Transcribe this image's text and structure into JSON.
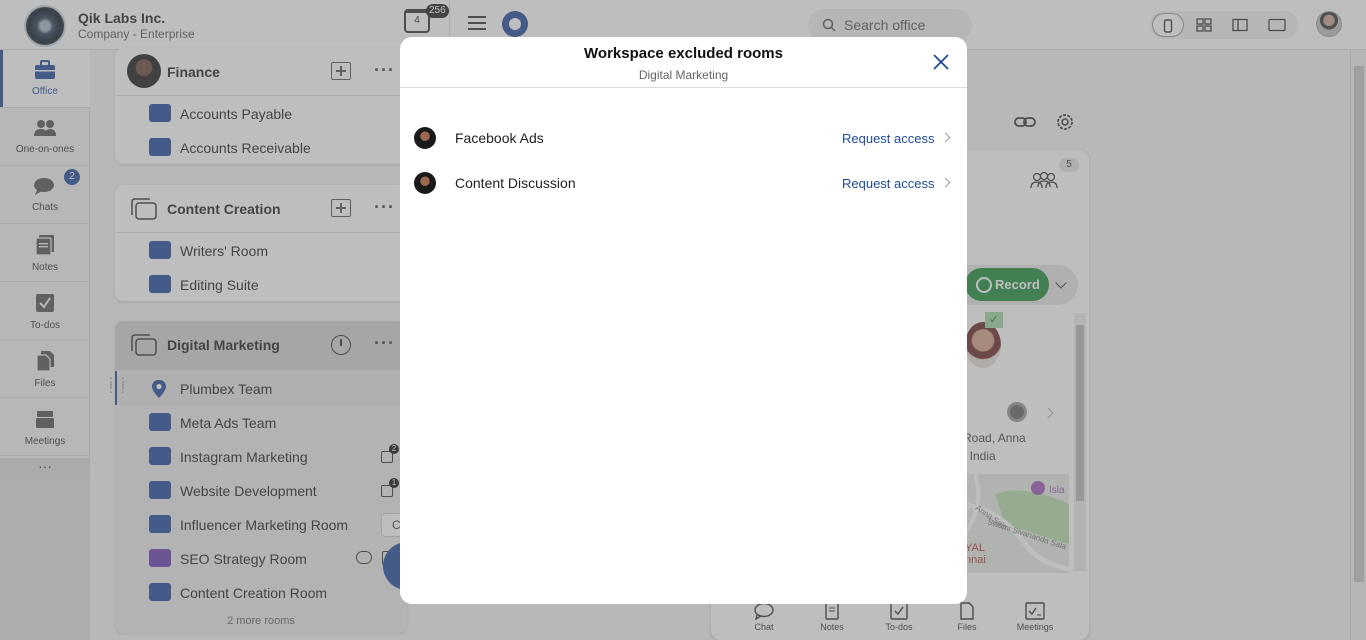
{
  "header": {
    "company_name": "Qik Labs Inc.",
    "company_plan": "Company - Enterprise",
    "calendar_day": "4",
    "calendar_badge": "256",
    "search_placeholder": "Search office"
  },
  "nav": {
    "items": [
      {
        "label": "Office"
      },
      {
        "label": "One-on-ones"
      },
      {
        "label": "Chats",
        "badge": "2"
      },
      {
        "label": "Notes"
      },
      {
        "label": "To-dos"
      },
      {
        "label": "Files"
      },
      {
        "label": "Meetings"
      }
    ],
    "more": "···"
  },
  "workspaces": {
    "finance": {
      "title": "Finance",
      "rooms": [
        "Accounts Payable",
        "Accounts Receivable"
      ]
    },
    "content": {
      "title": "Content Creation",
      "rooms": [
        "Writers' Room",
        "Editing Suite"
      ]
    },
    "digital": {
      "title": "Digital Marketing",
      "rooms": [
        {
          "name": "Plumbex Team"
        },
        {
          "name": "Meta Ads Team"
        },
        {
          "name": "Instagram Marketing",
          "todo_badge": "2"
        },
        {
          "name": "Website Development",
          "todo_badge": "1"
        },
        {
          "name": "Influencer Marketing Room"
        },
        {
          "name": "SEO Strategy Room"
        },
        {
          "name": "Content Creation Room"
        }
      ],
      "more_rooms": "2 more rooms"
    }
  },
  "room_panel": {
    "participants_count": "5",
    "record_label": "Record",
    "address_line1": "Road, Anna",
    "address_line2": ", India",
    "map_labels": {
      "place": "Isla",
      "road": "Anna Sala",
      "road2": "Swami Sivananda Sala",
      "area1": "YAL",
      "area2": "nnai"
    },
    "tabs": [
      "Chat",
      "Notes",
      "To-dos",
      "Files",
      "Meetings"
    ]
  },
  "modal": {
    "title": "Workspace excluded rooms",
    "subtitle": "Digital Marketing",
    "rooms": [
      {
        "name": "Facebook Ads",
        "action": "Request access"
      },
      {
        "name": "Content Discussion",
        "action": "Request access"
      }
    ]
  }
}
